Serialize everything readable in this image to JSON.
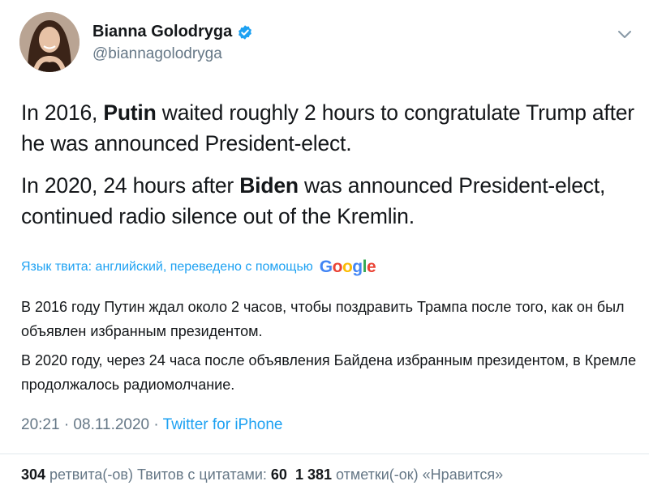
{
  "author": {
    "name": "Bianna Golodryga",
    "handle": "@biannagolodryga",
    "verified": true
  },
  "tweet": {
    "p1_pre": "In 2016, ",
    "p1_bold": "Putin",
    "p1_post": " waited roughly 2 hours to congratulate Trump after he was announced President-elect.",
    "p2_pre": "In 2020, 24 hours after ",
    "p2_bold": "Biden",
    "p2_post": " was announced President-elect, continued radio silence out of the Kremlin."
  },
  "translation": {
    "label": "Язык твита: английский, переведено с помощью",
    "provider": "Google",
    "p1": "В 2016 году Путин ждал около 2 часов, чтобы поздравить Трампа после того, как он был объявлен избранным президентом.",
    "p2": "В 2020 году, через 24 часа после объявления Байдена избранным президентом, в Кремле продолжалось радиомолчание."
  },
  "meta": {
    "time": "20:21 · 08.11.2020 · ",
    "source": "Twitter for iPhone"
  },
  "stats": {
    "retweets_count": "304",
    "retweets_label": " ретвита(-ов)  Твитов с цитатами: ",
    "quotes_count": "60",
    "likes_count": "1 381",
    "likes_label": " отметки(-ок) «Нравится»"
  },
  "colors": {
    "link": "#1da1f2",
    "muted": "#657786",
    "text": "#14171a"
  },
  "icons": [
    "avatar",
    "verified-badge-icon",
    "chevron-down-icon"
  ]
}
